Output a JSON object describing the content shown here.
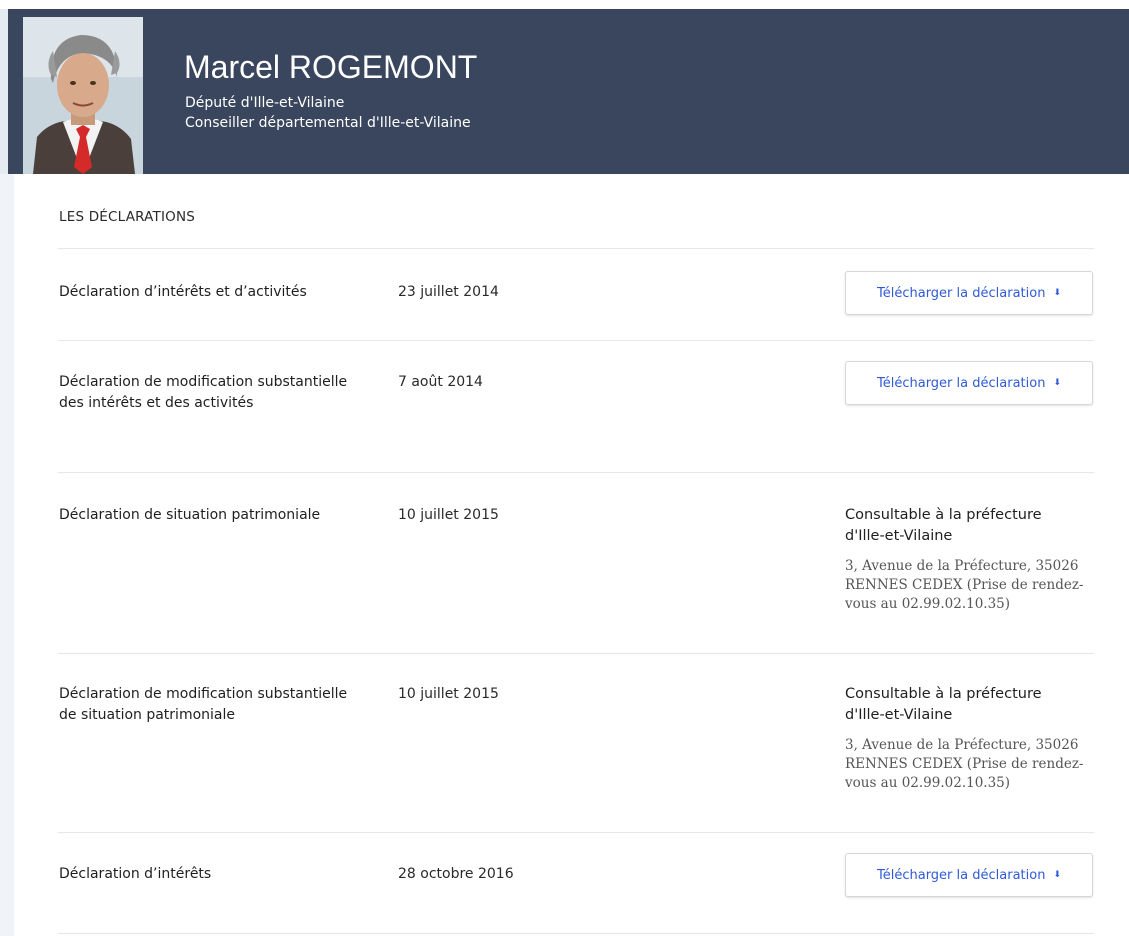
{
  "header": {
    "name": "Marcel ROGEMONT",
    "role_1": "Député d'Ille-et-Vilaine",
    "role_2": "Conseiller départemental d'Ille-et-Vilaine",
    "background": "#39465d"
  },
  "section": {
    "title": "LES DÉCLARATIONS"
  },
  "declarations": [
    {
      "title": "Déclaration d’intérêts et d’activités",
      "date": "23 juillet 2014",
      "action": "Télécharger la déclaration",
      "icon": "download-arrow-icon"
    },
    {
      "title": "Déclaration de modification substantielle des intérêts et des activités",
      "date": "7 août 2014",
      "action": "Télécharger la déclaration",
      "icon": "download-arrow-icon"
    },
    {
      "title": "Déclaration de situation patrimoniale",
      "date": "10 juillet 2015",
      "consult_title": "Consultable à la préfecture d'Ille-et-Vilaine",
      "consult_address": "3, Avenue de la Préfecture, 35026 RENNES CEDEX (Prise de rendez-vous au 02.99.02.10.35)"
    },
    {
      "title": "Déclaration de modification substantielle de situation patrimoniale",
      "date": "10 juillet 2015",
      "consult_title": "Consultable à la préfecture d'Ille-et-Vilaine",
      "consult_address": "3, Avenue de la Préfecture, 35026 RENNES CEDEX (Prise de rendez-vous au 02.99.02.10.35)"
    },
    {
      "title": "Déclaration d’intérêts",
      "date": "28 octobre 2016",
      "action": "Télécharger la déclaration",
      "icon": "download-arrow-icon"
    }
  ],
  "colors": {
    "accent": "#2f5bd6",
    "divider": "#e7e7e7"
  }
}
